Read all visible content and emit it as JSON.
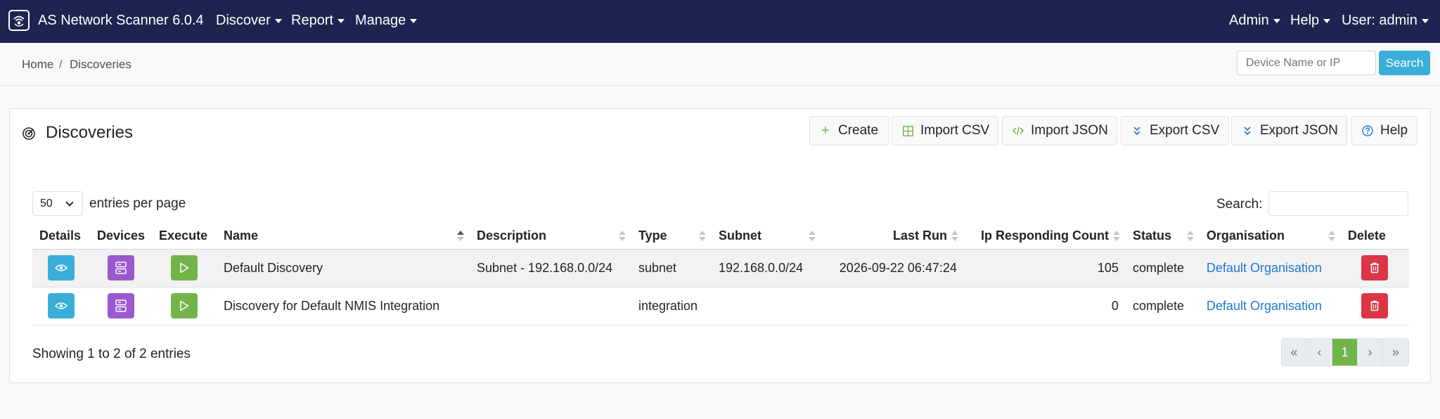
{
  "app": {
    "title": "AS Network Scanner 6.0.4",
    "logo_icon": "scanner-logo-icon"
  },
  "nav": {
    "discover": "Discover",
    "report": "Report",
    "manage": "Manage",
    "admin": "Admin",
    "help": "Help",
    "user": "User: admin"
  },
  "breadcrumb": {
    "home": "Home",
    "separator": "/",
    "current": "Discoveries"
  },
  "top_search": {
    "placeholder": "Device Name or IP",
    "button": "Search"
  },
  "card": {
    "title": "Discoveries",
    "title_icon": "radar-icon"
  },
  "toolbar": {
    "create": "Create",
    "import_csv": "Import CSV",
    "import_json": "Import JSON",
    "export_csv": "Export CSV",
    "export_json": "Export JSON",
    "help": "Help"
  },
  "table_controls": {
    "entries_value": "50",
    "entries_label": "entries per page",
    "search_label": "Search:"
  },
  "table": {
    "columns": {
      "details": "Details",
      "devices": "Devices",
      "execute": "Execute",
      "name": "Name",
      "description": "Description",
      "type": "Type",
      "subnet": "Subnet",
      "last_run": "Last Run",
      "ip_responding_count": "Ip Responding Count",
      "status": "Status",
      "organisation": "Organisation",
      "delete": "Delete"
    },
    "rows": [
      {
        "name": "Default Discovery",
        "description": "Subnet - 192.168.0.0/24",
        "type": "subnet",
        "subnet": "192.168.0.0/24",
        "last_run": "2026-09-22 06:47:24",
        "ip_responding_count": "105",
        "status": "complete",
        "organisation": "Default Organisation"
      },
      {
        "name": "Discovery for Default NMIS Integration",
        "description": "",
        "type": "integration",
        "subnet": "",
        "last_run": "",
        "ip_responding_count": "0",
        "status": "complete",
        "organisation": "Default Organisation"
      }
    ]
  },
  "footer": {
    "showing": "Showing 1 to 2 of 2 entries",
    "pager": {
      "first": "«",
      "prev": "‹",
      "current": "1",
      "next": "›",
      "last": "»"
    }
  },
  "colors": {
    "navbar": "#1e2450",
    "info": "#3aaed8",
    "purple": "#9b59d0",
    "success": "#73b44a",
    "danger": "#dc3545",
    "link": "#1f78d1"
  }
}
